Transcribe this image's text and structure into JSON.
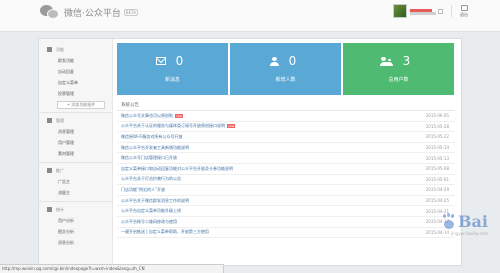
{
  "header": {
    "logo_text": "微信·公众平台",
    "beta": "BETA",
    "logout_label": "退出"
  },
  "sidebar": {
    "groups": [
      {
        "title": "功能",
        "icon": "grid-icon",
        "items": [
          "群发功能",
          "自动回复",
          "自定义菜单",
          "投票管理"
        ],
        "add_button": "+ 添加功能插件"
      },
      {
        "title": "管理",
        "icon": "folder-icon",
        "items": [
          "消息管理",
          "用户管理",
          "素材管理"
        ]
      },
      {
        "title": "推广",
        "icon": "megaphone-icon",
        "items": [
          "广告主",
          "流量主"
        ]
      },
      {
        "title": "统计",
        "icon": "chart-icon",
        "items": [
          "用户分析",
          "图文分析",
          "消息分析"
        ]
      }
    ]
  },
  "tiles": [
    {
      "value": "0",
      "label": "新消息",
      "icon": "envelope-icon",
      "color": "#5aa8d6"
    },
    {
      "value": "0",
      "label": "新增人数",
      "icon": "person-icon",
      "color": "#5aa8d6"
    },
    {
      "value": "3",
      "label": "总用户数",
      "icon": "people-icon",
      "color": "#4fbb72"
    }
  ],
  "notices": {
    "title": "系统公告",
    "items": [
      {
        "text": "微信公众号文章也可以原创啦",
        "new": true,
        "date": "2015-06-05"
      },
      {
        "text": "公众平台关于认证的服务与媒体类订阅号开放原创接口说明",
        "new": true,
        "date": "2015-05-28"
      },
      {
        "text": "微信摇Wi-Fi服务对所有公众号开放",
        "new": false,
        "date": "2015-05-22"
      },
      {
        "text": "微信公众平台开发者工具新增功能说明",
        "new": false,
        "date": "2015-05-14"
      },
      {
        "text": "微信公众号门店管理接口已开放",
        "new": false,
        "date": "2015-05-13"
      },
      {
        "text": "自定义菜单接口和自动回复功能对公众平台开放及卡券功能说明",
        "new": false,
        "date": "2015-05-08"
      },
      {
        "text": "公众平台关于打击抄袭行为的公告",
        "new": false,
        "date": "2015-05-01"
      },
      {
        "text": "门店功能“附近的人”开放",
        "new": false,
        "date": "2015-04-29"
      },
      {
        "text": "公众平台关于微信群发消息工作的说明",
        "new": false,
        "date": "2015-04-25"
      },
      {
        "text": "公众平台自定义菜单功能升级上线",
        "new": false,
        "date": "2015-04-21"
      },
      {
        "text": "公众平台帐号二维码修改与使用",
        "new": false,
        "date": "2015-04-17"
      },
      {
        "text": "一键开启推送 | 自定义菜单帮助，开放第三方使用",
        "new": false,
        "date": "2015-04-14"
      }
    ]
  },
  "status_url": "http://mp.weixin.qq.com/cgi-bin/indexpage?t=wxm-index&lang=zh_CN",
  "watermark": {
    "text": "Bai",
    "sub": "jingyan.baidu.com"
  }
}
